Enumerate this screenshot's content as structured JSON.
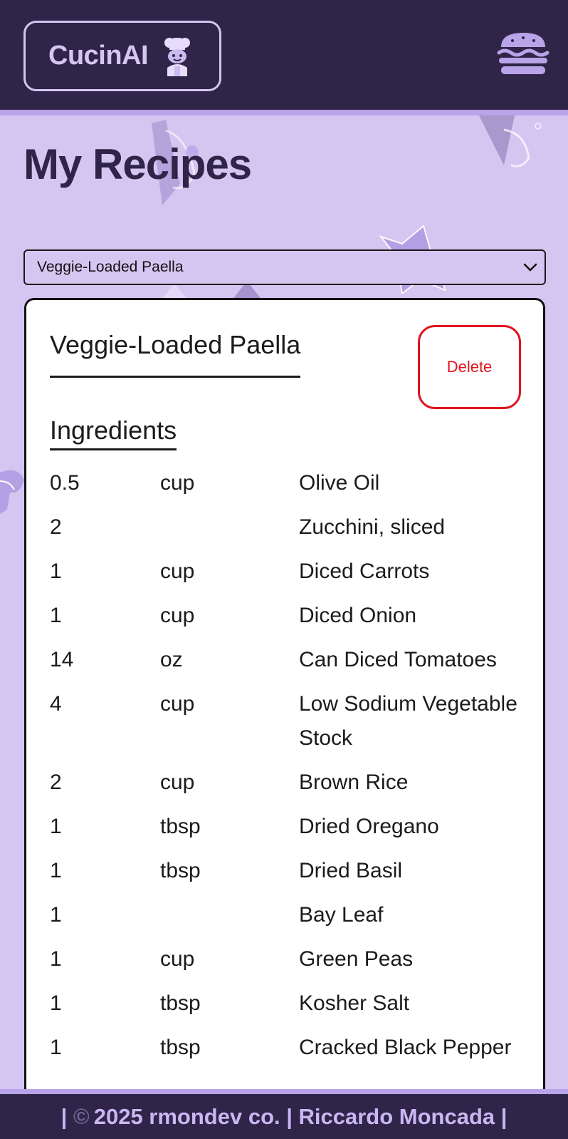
{
  "header": {
    "logo_text": "CucinAI",
    "logo_icon": "chef-icon",
    "menu_icon": "burger-menu-icon"
  },
  "page": {
    "title": "My Recipes"
  },
  "recipe_select": {
    "selected": "Veggie-Loaded Paella",
    "icon": "chevron-down-icon"
  },
  "recipe": {
    "title": "Veggie-Loaded Paella",
    "delete_label": "Delete",
    "ingredients_heading": "Ingredients",
    "ingredients": [
      {
        "qty": "0.5",
        "unit": "cup",
        "name": "Olive Oil"
      },
      {
        "qty": "2",
        "unit": "",
        "name": "Zucchini, sliced"
      },
      {
        "qty": "1",
        "unit": "cup",
        "name": "Diced Carrots"
      },
      {
        "qty": "1",
        "unit": "cup",
        "name": "Diced Onion"
      },
      {
        "qty": "14",
        "unit": "oz",
        "name": "Can Diced Tomatoes"
      },
      {
        "qty": "4",
        "unit": "cup",
        "name": "Low Sodium Vegetable Stock"
      },
      {
        "qty": "2",
        "unit": "cup",
        "name": "Brown Rice"
      },
      {
        "qty": "1",
        "unit": "tbsp",
        "name": "Dried Oregano"
      },
      {
        "qty": "1",
        "unit": "tbsp",
        "name": "Dried Basil"
      },
      {
        "qty": "1",
        "unit": "",
        "name": "Bay Leaf"
      },
      {
        "qty": "1",
        "unit": "cup",
        "name": "Green Peas"
      },
      {
        "qty": "1",
        "unit": "tbsp",
        "name": "Kosher Salt"
      },
      {
        "qty": "1",
        "unit": "tbsp",
        "name": "Cracked Black Pepper"
      }
    ]
  },
  "footer": {
    "left_sep": "|",
    "copyright_symbol": "©",
    "text": "2025 rmondev co. | Riccardo Moncada |"
  },
  "colors": {
    "header_bg": "#2e2548",
    "page_bg": "#d5c5f1",
    "accent": "#b9a4ea",
    "delete_red": "#e0141e"
  }
}
